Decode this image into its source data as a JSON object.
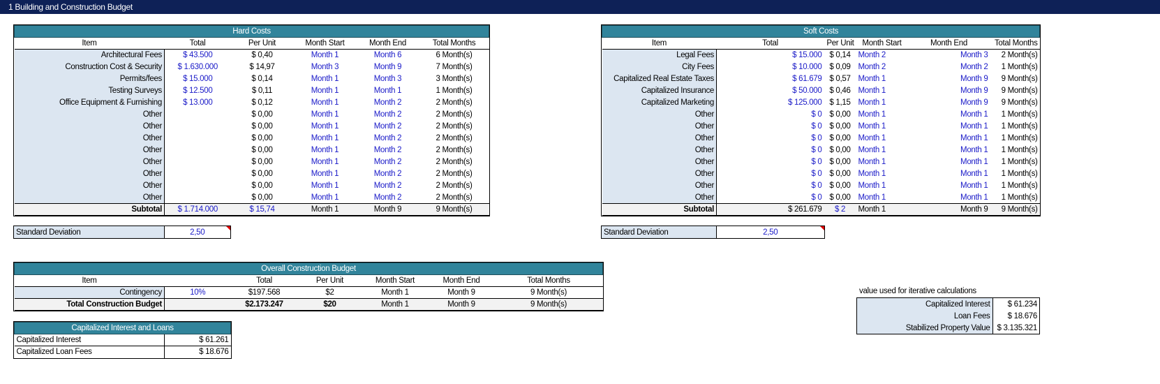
{
  "title": "1  Building and Construction Budget",
  "hard": {
    "title": "Hard Costs",
    "cols": [
      "Item",
      "Total",
      "Per Unit",
      "Month Start",
      "Month End",
      "Total Months"
    ],
    "rows": [
      [
        "Architectural Fees",
        "$ 43.500",
        "$ 0,40",
        "Month 1",
        "Month 6",
        "6 Month(s)"
      ],
      [
        "Construction Cost & Security",
        "$ 1.630.000",
        "$ 14,97",
        "Month 3",
        "Month 9",
        "7 Month(s)"
      ],
      [
        "Permits/fees",
        "$ 15.000",
        "$ 0,14",
        "Month 1",
        "Month 3",
        "3 Month(s)"
      ],
      [
        "Testing Surveys",
        "$ 12.500",
        "$ 0,11",
        "Month 1",
        "Month 1",
        "1 Month(s)"
      ],
      [
        "Office Equipment & Furnishing",
        "$ 13.000",
        "$ 0,12",
        "Month 1",
        "Month 2",
        "2 Month(s)"
      ],
      [
        "Other",
        "",
        "$ 0,00",
        "Month 1",
        "Month 2",
        "2 Month(s)"
      ],
      [
        "Other",
        "",
        "$ 0,00",
        "Month 1",
        "Month 2",
        "2 Month(s)"
      ],
      [
        "Other",
        "",
        "$ 0,00",
        "Month 1",
        "Month 2",
        "2 Month(s)"
      ],
      [
        "Other",
        "",
        "$ 0,00",
        "Month 1",
        "Month 2",
        "2 Month(s)"
      ],
      [
        "Other",
        "",
        "$ 0,00",
        "Month 1",
        "Month 2",
        "2 Month(s)"
      ],
      [
        "Other",
        "",
        "$ 0,00",
        "Month 1",
        "Month 2",
        "2 Month(s)"
      ],
      [
        "Other",
        "",
        "$ 0,00",
        "Month 1",
        "Month 2",
        "2 Month(s)"
      ],
      [
        "Other",
        "",
        "$ 0,00",
        "Month 1",
        "Month 2",
        "2 Month(s)"
      ]
    ],
    "subtotal": [
      "Subtotal",
      "$ 1.714.000",
      "$ 15,74",
      "Month 1",
      "Month 9",
      "9 Month(s)"
    ],
    "sd_label": "Standard Deviation",
    "sd_value": "2,50"
  },
  "soft": {
    "title": "Soft Costs",
    "cols": [
      "Item",
      "Total",
      "Per Unit",
      "Month Start",
      "Month End",
      "Total Months"
    ],
    "rows": [
      [
        "Legal Fees",
        "$ 15.000",
        "$ 0,14",
        "Month 2",
        "Month 3",
        "2 Month(s)"
      ],
      [
        "City Fees",
        "$ 10.000",
        "$ 0,09",
        "Month 2",
        "Month 2",
        "1 Month(s)"
      ],
      [
        "Capitalized Real Estate Taxes",
        "$ 61.679",
        "$ 0,57",
        "Month 1",
        "Month 9",
        "9 Month(s)"
      ],
      [
        "Capitalized Insurance",
        "$ 50.000",
        "$ 0,46",
        "Month 1",
        "Month 9",
        "9 Month(s)"
      ],
      [
        "Capitalized Marketing",
        "$ 125.000",
        "$ 1,15",
        "Month 1",
        "Month 9",
        "9 Month(s)"
      ],
      [
        "Other",
        "$ 0",
        "$ 0,00",
        "Month 1",
        "Month 1",
        "1 Month(s)"
      ],
      [
        "Other",
        "$ 0",
        "$ 0,00",
        "Month 1",
        "Month 1",
        "1 Month(s)"
      ],
      [
        "Other",
        "$ 0",
        "$ 0,00",
        "Month 1",
        "Month 1",
        "1 Month(s)"
      ],
      [
        "Other",
        "$ 0",
        "$ 0,00",
        "Month 1",
        "Month 1",
        "1 Month(s)"
      ],
      [
        "Other",
        "$ 0",
        "$ 0,00",
        "Month 1",
        "Month 1",
        "1 Month(s)"
      ],
      [
        "Other",
        "$ 0",
        "$ 0,00",
        "Month 1",
        "Month 1",
        "1 Month(s)"
      ],
      [
        "Other",
        "$ 0",
        "$ 0,00",
        "Month 1",
        "Month 1",
        "1 Month(s)"
      ],
      [
        "Other",
        "$ 0",
        "$ 0,00",
        "Month 1",
        "Month 1",
        "1 Month(s)"
      ]
    ],
    "subtotal": [
      "Subtotal",
      "$ 261.679",
      "$ 2",
      "Month 1",
      "Month 9",
      "9 Month(s)"
    ],
    "sd_label": "Standard Deviation",
    "sd_value": "2,50"
  },
  "overall": {
    "title": "Overall Construction Budget",
    "cols": [
      "Item",
      "",
      "Total",
      "Per Unit",
      "Month Start",
      "Month End",
      "Total Months"
    ],
    "contingency": [
      "Contingency",
      "10%",
      "$197.568",
      "$2",
      "Month 1",
      "Month 9",
      "9 Month(s)"
    ],
    "total": [
      "Total Construction Budget",
      "",
      "$2.173.247",
      "$20",
      "Month 1",
      "Month 9",
      "9 Month(s)"
    ]
  },
  "cap": {
    "title": "Capitalized Interest and Loans",
    "rows": [
      [
        "Capitalized Interest",
        "$ 61.261"
      ],
      [
        "Capitalized Loan Fees",
        "$ 18.676"
      ]
    ]
  },
  "iter": {
    "note": "value used for iterative calculations",
    "rows": [
      [
        "Capitalized Interest",
        "$ 61.234"
      ],
      [
        "Loan Fees",
        "$ 18.676"
      ],
      [
        "Stabilized Property Value",
        "$ 3.135.321"
      ]
    ]
  }
}
